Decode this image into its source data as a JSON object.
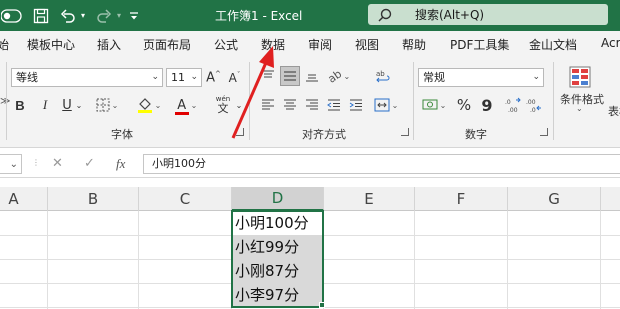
{
  "window": {
    "title": "工作簿1  -  Excel",
    "accent": "#217346",
    "search_placeholder": "搜索(Alt+Q)",
    "quick_access": [
      "save-icon",
      "undo-icon",
      "redo-icon",
      "customize-icon"
    ]
  },
  "tabs": [
    "模板中心",
    "插入",
    "页面布局",
    "公式",
    "数据",
    "审阅",
    "视图",
    "帮助",
    "PDF工具集",
    "金山文档",
    "Acr"
  ],
  "ribbon": {
    "font_name": "等线",
    "font_size": "11",
    "font_group_label": "字体",
    "align_group_label": "对齐方式",
    "number_group_label": "数字",
    "number_format": "常规",
    "conditional_format": "条件格式",
    "table_partial": "表格",
    "bold": "B",
    "italic": "I",
    "underline": "U",
    "font_color_letter": "A",
    "phonetic": "wén",
    "percent": "%",
    "comma": "9"
  },
  "formula_bar": {
    "cancel": "✕",
    "confirm": "✓",
    "fx": "fx",
    "content": "小明100分"
  },
  "grid": {
    "columns": [
      "A",
      "B",
      "C",
      "D",
      "E",
      "F",
      "G"
    ],
    "selected_column": "D",
    "cells": [
      "小明100分",
      "小红99分",
      "小刚87分",
      "小李97分"
    ]
  }
}
